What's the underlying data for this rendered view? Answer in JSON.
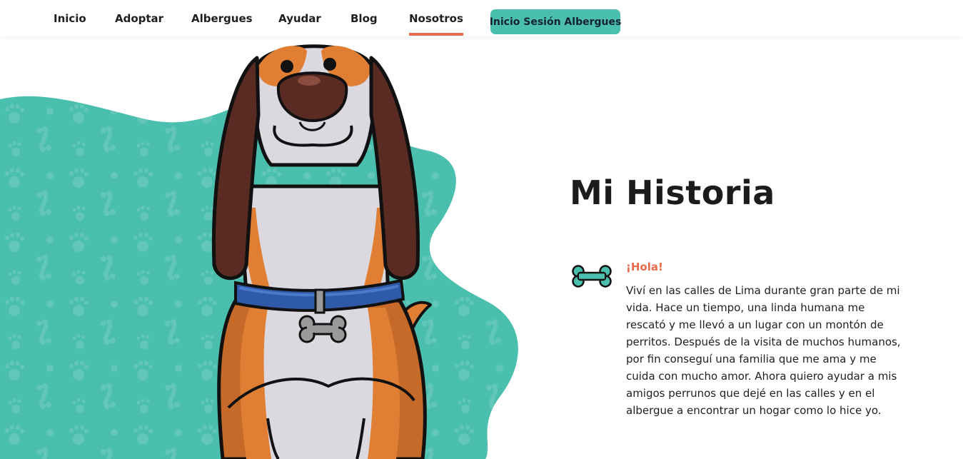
{
  "nav": {
    "items": [
      {
        "label": "Inicio"
      },
      {
        "label": "Adoptar"
      },
      {
        "label": "Albergues"
      },
      {
        "label": "Ayudar"
      },
      {
        "label": "Blog"
      },
      {
        "label": "Nosotros",
        "active": true
      }
    ],
    "login_button": "Inicio Sesión Albergues"
  },
  "story": {
    "title": "Mi Historia",
    "greeting": "¡Hola!",
    "body": "Viví en las calles de Lima durante gran parte de mi vida. Hace un tiempo, una linda humana me rescató y me llevó a un lugar con un montón de perritos. Después de la visita de muchos humanos, por fin conseguí una familia que me ama y me cuida con mucho amor. Ahora quiero ayudar a mis amigos perrunos que dejé en las calles y en el albergue a encontrar un hogar como lo hice yo."
  },
  "colors": {
    "accent_teal": "#4bbfad",
    "accent_orange": "#ea6a4d",
    "text_dark": "#1f1f1f"
  },
  "icons": {
    "bone": "bone-icon",
    "dog": "dog-illustration",
    "paw_pattern": "paw-print-icon"
  }
}
